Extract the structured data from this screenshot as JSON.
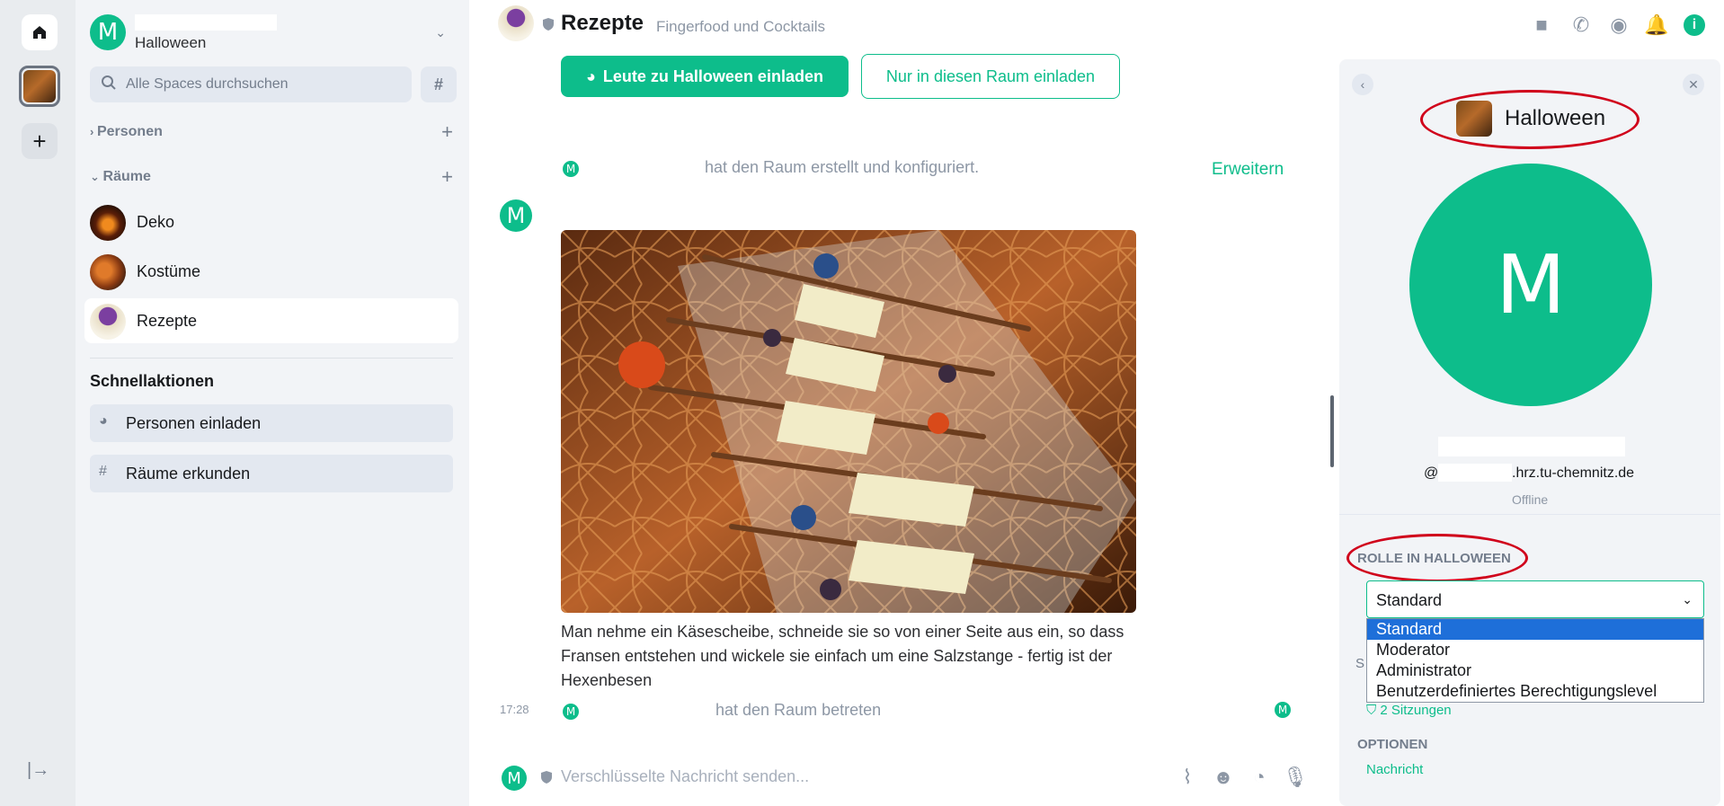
{
  "rail": {
    "home_icon": "home-icon",
    "space_name": "Halloween",
    "add_icon": "plus-icon",
    "add_label": "+",
    "collapse_label": "|→"
  },
  "space_header": {
    "avatar_letter": "M",
    "name": "Halloween",
    "chevron": "⌄"
  },
  "search": {
    "placeholder": "Alle Spaces durchsuchen"
  },
  "sections": {
    "people": {
      "label": "Personen",
      "add": "+"
    },
    "rooms": {
      "label": "Räume",
      "add": "+"
    }
  },
  "rooms": [
    {
      "label": "Deko",
      "active": false
    },
    {
      "label": "Kostüme",
      "active": false
    },
    {
      "label": "Rezepte",
      "active": true
    }
  ],
  "quick_actions": {
    "title": "Schnellaktionen",
    "items": [
      {
        "label": "Personen einladen",
        "icon": "invite-icon"
      },
      {
        "label": "Räume erkunden",
        "icon": "explore-rooms-icon"
      }
    ]
  },
  "room": {
    "title": "Rezepte",
    "topic": "Fingerfood und Cocktails"
  },
  "header_icons": [
    "video-call-icon",
    "voice-call-icon",
    "room-search-icon",
    "notifications-icon",
    "room-info-icon"
  ],
  "timeline": {
    "invite_space_label": "Leute zu Halloween einladen",
    "invite_room_label": "Nur in diesen Raum einladen",
    "created_text": "hat den Raum erstellt und konfiguriert.",
    "expand_label": "Erweitern",
    "sender_letter": "M",
    "message_text": "Man nehme ein Käsescheibe, schneide sie so von einer Seite aus ein, so dass Fransen entstehen und wickele sie einfach um eine Salzstange - fertig ist der Hexenbesen",
    "time": "17:28",
    "joined_text": "hat den Raum betreten"
  },
  "composer": {
    "avatar_letter": "M",
    "placeholder": "Verschlüsselte Nachricht senden...",
    "icons": [
      "attachment-icon",
      "emoji-icon",
      "sticker-icon",
      "microphone-icon"
    ]
  },
  "right_panel": {
    "space_name": "Halloween",
    "avatar_letter": "M",
    "userid_prefix": "@",
    "userid_domain": ".hrz.tu-chemnitz.de",
    "status": "Offline",
    "role_heading": "ROLLE IN HALLOWEEN",
    "role_value": "Standard",
    "role_options": [
      "Standard",
      "Moderator",
      "Administrator",
      "Benutzerdefiniertes Berechtigungslevel"
    ],
    "hidden_section_initial": "S",
    "sessions": "2 Sitzungen",
    "options_heading": "OPTIONEN",
    "message_link": "Nachricht",
    "highlight_color": "#d0021b"
  },
  "colors": {
    "accent": "#0dbd8b",
    "select_highlight": "#1e6fd9"
  }
}
